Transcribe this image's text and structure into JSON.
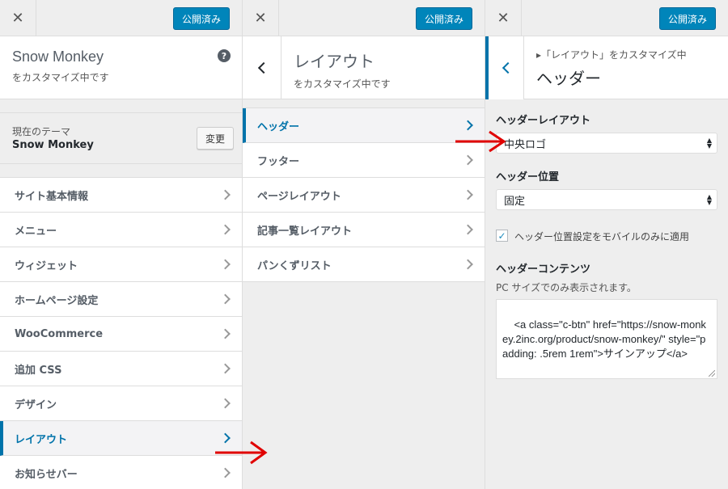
{
  "panel1": {
    "close_icon": "close-icon",
    "publish_label": "公開済み",
    "title": "Snow Monkey",
    "subtitle": "をカスタマイズ中です",
    "help_icon": "?",
    "theme_label": "現在のテーマ",
    "theme_name": "Snow Monkey",
    "change_label": "変更",
    "menu": [
      {
        "label": "サイト基本情報",
        "active": false
      },
      {
        "label": "メニュー",
        "active": false
      },
      {
        "label": "ウィジェット",
        "active": false
      },
      {
        "label": "ホームページ設定",
        "active": false
      },
      {
        "label": "WooCommerce",
        "active": false
      },
      {
        "label": "追加 CSS",
        "active": false
      },
      {
        "label": "デザイン",
        "active": false
      },
      {
        "label": "レイアウト",
        "active": true
      },
      {
        "label": "お知らせバー",
        "active": false
      }
    ]
  },
  "panel2": {
    "publish_label": "公開済み",
    "title": "レイアウト",
    "subtitle": "をカスタマイズ中です",
    "menu": [
      {
        "label": "ヘッダー",
        "active": true
      },
      {
        "label": "フッター",
        "active": false
      },
      {
        "label": "ページレイアウト",
        "active": false
      },
      {
        "label": "記事一覧レイアウト",
        "active": false
      },
      {
        "label": "パンくずリスト",
        "active": false
      }
    ]
  },
  "panel3": {
    "publish_label": "公開済み",
    "breadcrumb": "▸「レイアウト」をカスタマイズ中",
    "title": "ヘッダー",
    "header_layout_label": "ヘッダーレイアウト",
    "header_layout_value": "中央ロゴ",
    "header_position_label": "ヘッダー位置",
    "header_position_value": "固定",
    "mobile_only_checked": true,
    "mobile_only_label": "ヘッダー位置設定をモバイルのみに適用",
    "header_contents_label": "ヘッダーコンテンツ",
    "header_contents_desc": "PC サイズでのみ表示されます。",
    "header_contents_value": "<a class=\"c-btn\" href=\"https://snow-monkey.2inc.org/product/snow-monkey/\" style=\"padding: .5rem 1rem\">サインアップ</a>"
  },
  "colors": {
    "accent": "#0073aa",
    "publish": "#0085ba",
    "annotation_arrow": "#e00000"
  }
}
